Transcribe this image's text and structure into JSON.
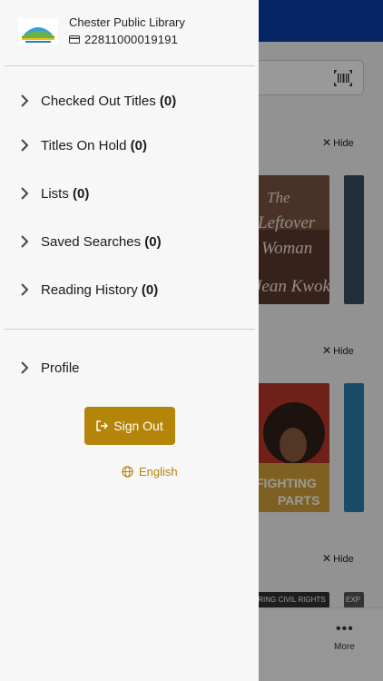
{
  "drawer": {
    "library_name": "Chester Public Library",
    "card_number": "22811000019191",
    "menu": [
      {
        "label": "Checked Out Titles",
        "count": "(0)"
      },
      {
        "label": "Titles On Hold",
        "count": "(0)"
      },
      {
        "label": "Lists",
        "count": "(0)"
      },
      {
        "label": "Saved Searches",
        "count": "(0)"
      },
      {
        "label": "Reading History",
        "count": "(0)"
      }
    ],
    "profile_label": "Profile",
    "sign_out_label": "Sign Out",
    "language_label": "English",
    "theme_icon": "moon-icon",
    "language_icon": "globe-icon"
  },
  "background": {
    "section_title_fragment": "t",
    "hide_label": "Hide",
    "book_titles": [
      "The Leftover Woman",
      "Fighting Parts"
    ],
    "book_authors": [
      "Jean Kwok"
    ],
    "book_fragments": [
      "ORING CIVIL RIGHTS",
      "EXP"
    ],
    "more_label": "More",
    "tab_label_fragment": "t"
  },
  "colors": {
    "header_blue": "#0a3ea8",
    "accent_gold": "#b5850a",
    "drawer_bg": "#f7f7f7",
    "moon_blue": "#1a3d8f"
  }
}
